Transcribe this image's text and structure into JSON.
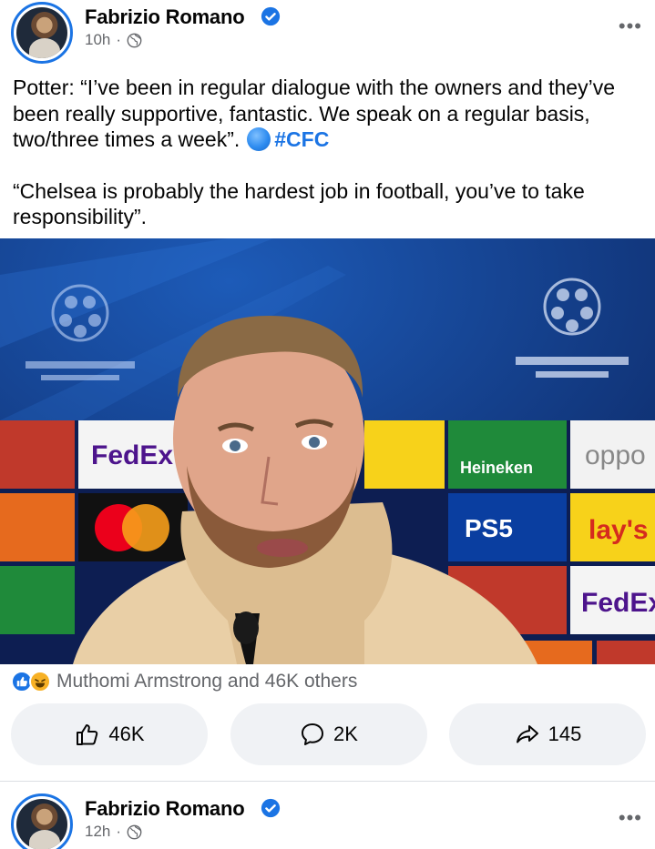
{
  "post1": {
    "author": "Fabrizio Romano",
    "time": "10h",
    "separator": "·",
    "text_line1": "Potter: “I’ve been in regular dialogue with the owners and they’ve",
    "text_line2": "been really supportive, fantastic. We speak on a regular basis,",
    "text_line3": "two/three times a week”.",
    "hashtag": "#CFC",
    "quote_line1": "“Chelsea is probably the hardest job in football, you’ve to take",
    "quote_line2": "responsibility”.",
    "image_texts": {
      "fedex": "FedEx",
      "ps5": "PS5",
      "lays": "lay's",
      "heineken": "Heineken",
      "oppo": "oppo"
    },
    "reactions_text": "Muthomi Armstrong and 46K others",
    "likes": "46K",
    "comments": "2K",
    "shares": "145"
  },
  "post2": {
    "author": "Fabrizio Romano",
    "time": "12h",
    "separator": "·"
  },
  "icons": {
    "more": "more-options-icon",
    "globe": "globe-icon",
    "verified": "verified-badge-icon",
    "like": "thumbs-up-icon",
    "comment": "comment-icon",
    "share": "share-icon"
  },
  "colors": {
    "accent": "#1b74e4",
    "secondary_text": "#65676b",
    "button_bg": "#f0f2f5"
  }
}
